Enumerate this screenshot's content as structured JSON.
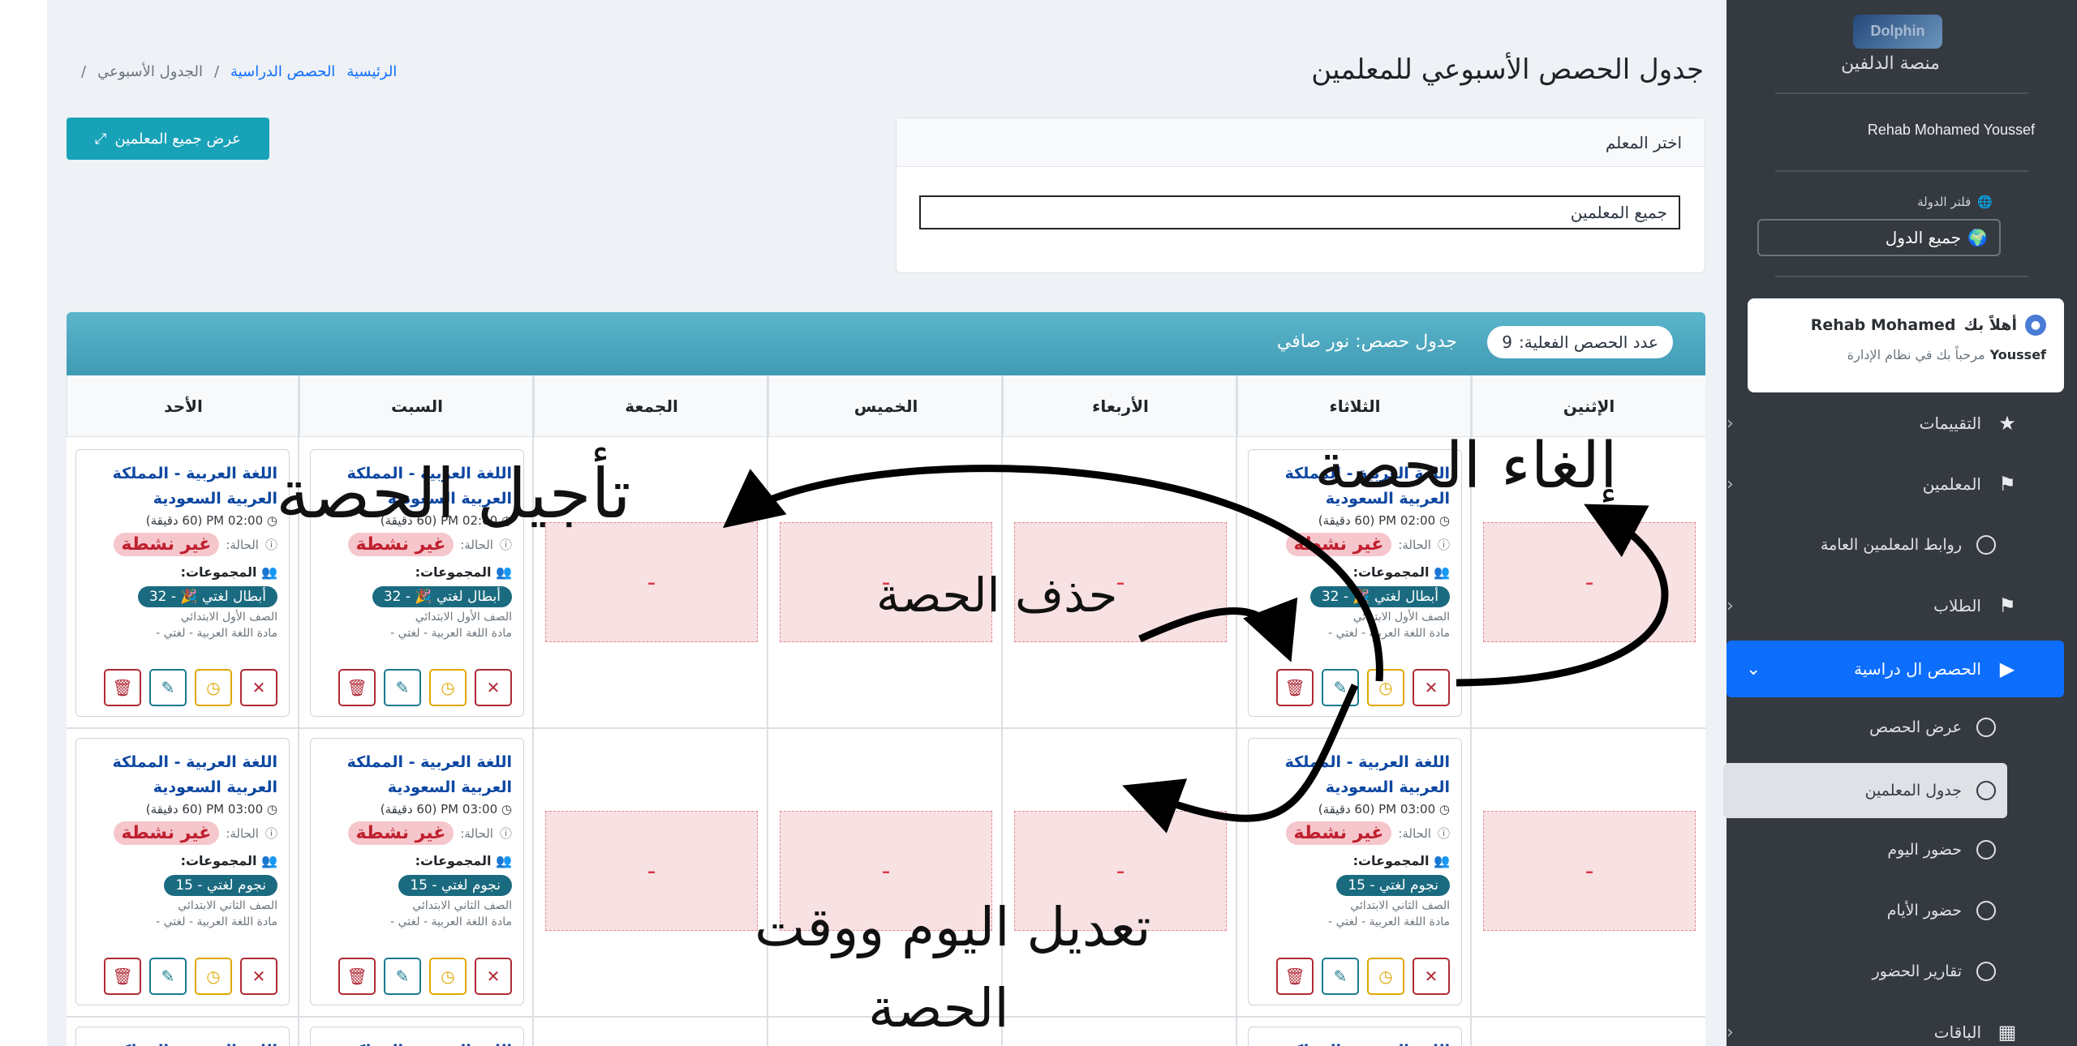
{
  "sidebar": {
    "brand_logo_text": "Dolphin",
    "brand_name": "منصة الدلفين",
    "user_name": "Rehab Mohamed Youssef",
    "country_filter": {
      "label": "فلتر الدولة",
      "value": "جميع الدول"
    },
    "welcome": {
      "greeting": "أهلاً بك",
      "name_first": "Rehab Mohamed",
      "name_last": "Youssef",
      "subtitle": "مرحباً بك في نظام الإدارة"
    },
    "items": [
      {
        "label": "التقييمات",
        "icon": "star-icon"
      },
      {
        "label": "المعلمين",
        "icon": "teacher-icon"
      },
      {
        "label": "روابط المعلمين العامة",
        "icon": "circle-icon"
      },
      {
        "label": "الطلاب",
        "icon": "student-icon"
      },
      {
        "label": "الحصص ال دراسية",
        "icon": "video-icon"
      },
      {
        "label": "عرض الحصص",
        "icon": "circle-icon"
      },
      {
        "label": "جدول المعلمين",
        "icon": "circle-icon"
      },
      {
        "label": "حضور اليوم",
        "icon": "circle-icon"
      },
      {
        "label": "حضور الأيام",
        "icon": "circle-icon"
      },
      {
        "label": "تقارير الحضور",
        "icon": "circle-icon"
      },
      {
        "label": "الباقات",
        "icon": "package-icon"
      }
    ]
  },
  "header": {
    "title": "جدول الحصص الأسبوعي للمعلمين",
    "breadcrumb": {
      "home": "الرئيسية",
      "sessions": "الحصص الدراسية",
      "current": "الجدول الأسبوعي",
      "sep": "/"
    },
    "show_all_button": "عرض جميع المعلمين"
  },
  "teacher_picker": {
    "label": "اختر المعلم",
    "value": "جميع المعلمين"
  },
  "schedule": {
    "count_label": "عدد الحصص الفعلية:",
    "count_value": "9",
    "title": "جدول حصص: نور صافي",
    "days": [
      "الإثنين",
      "الثلاثاء",
      "الأربعاء",
      "الخميس",
      "الجمعة",
      "السبت",
      "الأحد"
    ],
    "empty_mark": "-",
    "session_title": "اللغة العربية - المملكة العربية السعودية",
    "status_label": "الحالة:",
    "status_value": "غير نشطة",
    "groups_label": "المجموعات:",
    "subject": "مادة اللغة العربية - لغتي -",
    "row1": {
      "time": "02:00 PM (60 دقيقة)",
      "group": "أبطال لغتي 🎉 - 32",
      "grade": "الصف الأول الابتدائي"
    },
    "row2": {
      "time": "03:00 PM (60 دقيقة)",
      "group": "نجوم لغتي - 15",
      "grade": "الصف الثاني الابتدائي"
    }
  },
  "annotations": {
    "cancel": "إلغاء الحصة",
    "postpone": "تأجيل الحصة",
    "delete": "حذف الحصة",
    "edit_line1": "تعديل اليوم ووقت",
    "edit_line2": "الحصة"
  }
}
